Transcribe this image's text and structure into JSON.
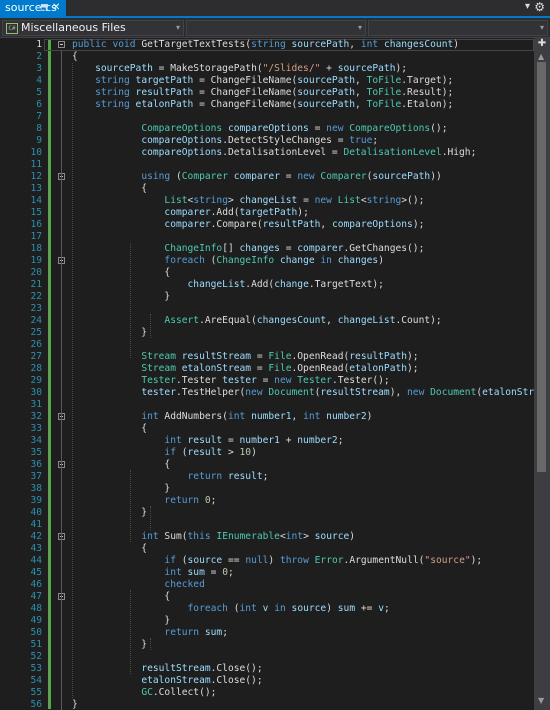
{
  "tab": {
    "title": "source.cs",
    "pin_icon": "pin-icon",
    "close_icon": "close-icon"
  },
  "tab_dropdown_icon": "chevron-down-icon",
  "settings_icon": "gear-icon",
  "navbar": {
    "project": "Miscellaneous Files",
    "project_icon": "C#",
    "type_member": "",
    "member": ""
  },
  "current_line": 1,
  "colors": {
    "accent": "#007acc",
    "keyword": "#569cd6",
    "type": "#4ec9b0",
    "string": "#d69d85",
    "number": "#b5cea8",
    "line_number": "#2b91af",
    "change_bar": "#57a64a"
  },
  "code": [
    "    public void GetTargetTextTests(string sourcePath, int changesCount)",
    "    {",
    "        sourcePath = MakeStoragePath(\"/Slides/\" + sourcePath);",
    "        string targetPath = ChangeFileName(sourcePath, ToFile.Target);",
    "        string resultPath = ChangeFileName(sourcePath, ToFile.Result);",
    "        string etalonPath = ChangeFileName(sourcePath, ToFile.Etalon);",
    "",
    "                CompareOptions compareOptions = new CompareOptions();",
    "                compareOptions.DetectStyleChanges = true;",
    "                compareOptions.DetalisationLevel = DetalisationLevel.High;",
    "",
    "                using (Comparer comparer = new Comparer(sourcePath))",
    "                {",
    "                    List<string> changeList = new List<string>();",
    "                    comparer.Add(targetPath);",
    "                    comparer.Compare(resultPath, compareOptions);",
    "",
    "                    ChangeInfo[] changes = comparer.GetChanges();",
    "                    foreach (ChangeInfo change in changes)",
    "                    {",
    "                        changeList.Add(change.TargetText);",
    "                    }",
    "",
    "                    Assert.AreEqual(changesCount, changeList.Count);",
    "                }",
    "",
    "                Stream resultStream = File.OpenRead(resultPath);",
    "                Stream etalonStream = File.OpenRead(etalonPath);",
    "                Tester.Tester tester = new Tester.Tester();",
    "                tester.TestHelper(new Document(resultStream), new Document(etalonStream));",
    "",
    "                int AddNumbers(int number1, int number2)",
    "                {",
    "                    int result = number1 + number2;",
    "                    if (result > 10)",
    "                    {",
    "                        return result;",
    "                    }",
    "                    return 0;",
    "                }",
    "",
    "                int Sum(this IEnumerable<int> source)",
    "                {",
    "                    if (source == null) throw Error.ArgumentNull(\"source\");",
    "                    int sum = 0;",
    "                    checked",
    "                    {",
    "                        foreach (int v in source) sum += v;",
    "                    }",
    "                    return sum;",
    "                }",
    "",
    "                resultStream.Close();",
    "                etalonStream.Close();",
    "                GC.Collect();",
    "    }"
  ]
}
